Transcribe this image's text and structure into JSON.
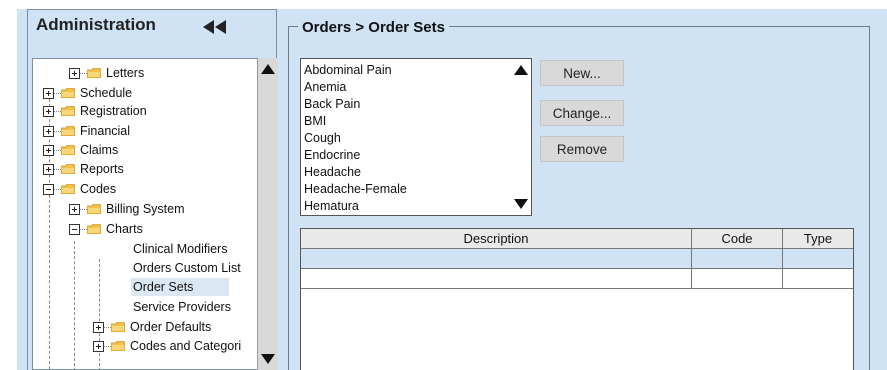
{
  "sidebar": {
    "title": "Administration",
    "tree": [
      {
        "label": "Letters",
        "expander": "plus"
      },
      {
        "label": "Schedule",
        "expander": "plus"
      },
      {
        "label": "Registration",
        "expander": "plus"
      },
      {
        "label": "Financial",
        "expander": "plus"
      },
      {
        "label": "Claims",
        "expander": "plus"
      },
      {
        "label": "Reports",
        "expander": "plus"
      },
      {
        "label": "Codes",
        "expander": "minus"
      },
      {
        "label": "Billing System",
        "expander": "plus"
      },
      {
        "label": "Charts",
        "expander": "minus"
      },
      {
        "label": "Clinical Modifiers"
      },
      {
        "label": "Orders Custom List"
      },
      {
        "label": "Order Sets",
        "selected": true
      },
      {
        "label": "Service Providers"
      },
      {
        "label": "Order Defaults",
        "expander": "plus"
      },
      {
        "label": "Codes and Categori",
        "expander": "plus"
      }
    ]
  },
  "main": {
    "group_title": "Orders > Order Sets",
    "order_sets": [
      "Abdominal Pain",
      "Anemia",
      "Back Pain",
      "BMI",
      "Cough",
      "Endocrine",
      "Headache",
      "Headache-Female",
      "Hematura"
    ],
    "buttons": {
      "new": "New...",
      "change": "Change...",
      "remove": "Remove"
    },
    "table": {
      "columns": [
        "Description",
        "Code",
        "Type"
      ],
      "rows": [
        [
          "",
          "",
          ""
        ],
        [
          "",
          "",
          ""
        ]
      ]
    }
  },
  "colors": {
    "panel_bg": "#cfe3f4",
    "selected_row": "#dbe8f3",
    "button_bg": "#d9d9d9"
  },
  "icons": {
    "collapse": "double-left-chevron-icon",
    "folder": "folder-icon",
    "expand": "plus-box-icon",
    "collapse_node": "minus-box-icon"
  }
}
